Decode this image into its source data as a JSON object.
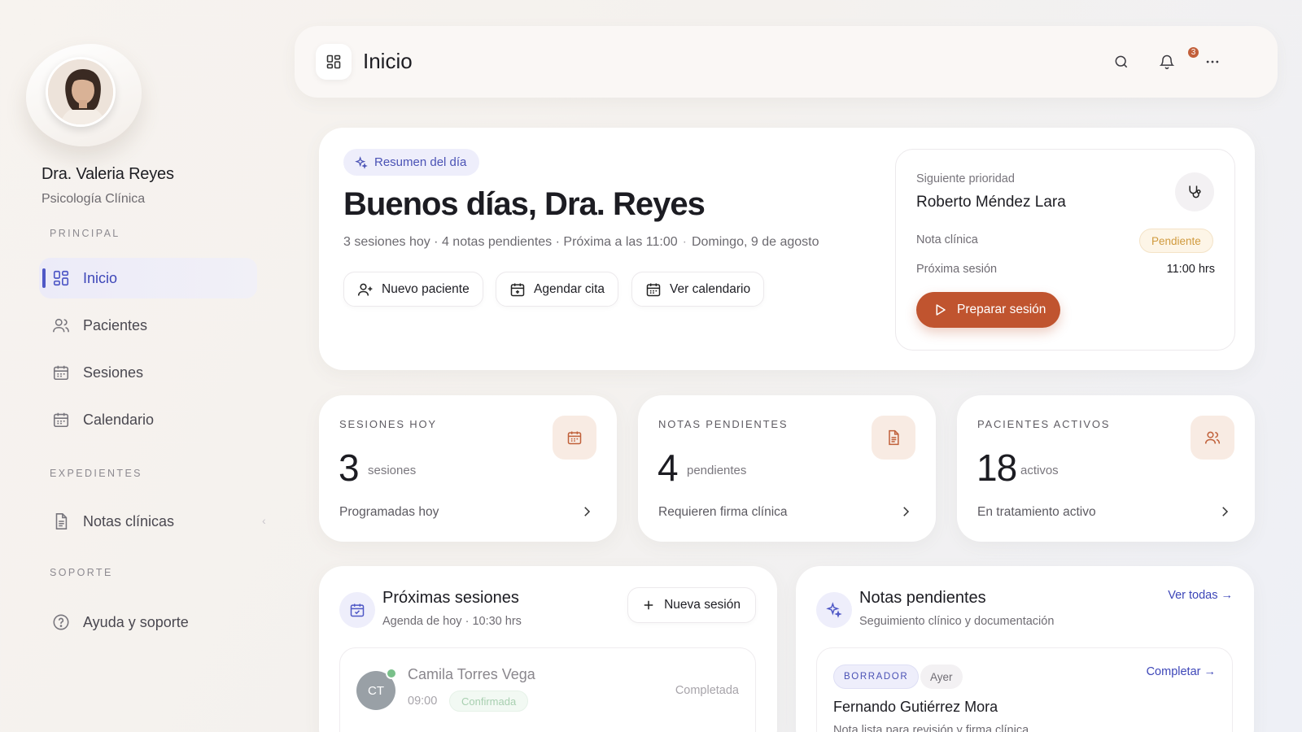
{
  "sidebar": {
    "doctor_name": "Dra. Valeria Reyes",
    "specialty": "Psicología Clínica",
    "sections": {
      "principal": "PRINCIPAL",
      "expedientes": "EXPEDIENTES",
      "soporte": "SOPORTE"
    },
    "items": [
      {
        "label": "Inicio",
        "icon": "dashboard-icon",
        "active": true
      },
      {
        "label": "Pacientes",
        "icon": "users-icon"
      },
      {
        "label": "Sesiones",
        "icon": "calendar-icon"
      },
      {
        "label": "Calendario",
        "icon": "calendar-icon"
      },
      {
        "label": "Notas clínicas",
        "icon": "document-icon"
      },
      {
        "label": "Ayuda y soporte",
        "icon": "help-icon"
      }
    ]
  },
  "topbar": {
    "title": "Inicio",
    "notification_count": "3"
  },
  "hero": {
    "summary_pill": "Resumen del día",
    "greeting": "Buenos días, Dra. Reyes",
    "summary": "3 sesiones hoy · 4 notas pendientes · Próxima a las 11:00",
    "date": "Domingo, 9 de agosto",
    "actions": {
      "new_patient": "Nuevo paciente",
      "schedule": "Agendar cita",
      "calendar": "Ver calendario"
    }
  },
  "priority": {
    "label": "Siguiente prioridad",
    "patient": "Roberto Méndez Lara",
    "note_label": "Nota clínica",
    "note_status": "Pendiente",
    "next_label": "Próxima sesión",
    "next_time": "11:00 hrs",
    "button": "Preparar sesión"
  },
  "stats": [
    {
      "label": "SESIONES HOY",
      "value": "3",
      "unit": "sesiones",
      "footer": "Programadas hoy",
      "icon": "calendar-icon"
    },
    {
      "label": "NOTAS PENDIENTES",
      "value": "4",
      "unit": "pendientes",
      "footer": "Requieren firma clínica",
      "icon": "document-icon"
    },
    {
      "label": "PACIENTES ACTIVOS",
      "value": "18",
      "unit": "activos",
      "footer": "En tratamiento activo",
      "icon": "users-icon"
    }
  ],
  "upcoming": {
    "title": "Próximas sesiones",
    "subtitle": "Agenda de hoy · 10:30 hrs",
    "button": "Nueva sesión",
    "sessions": [
      {
        "initials": "CT",
        "name": "Camila Torres Vega",
        "time": "09:00",
        "status": "Confirmada",
        "state": "Completada"
      }
    ]
  },
  "notes": {
    "title": "Notas pendientes",
    "subtitle": "Seguimiento clínico y documentación",
    "link": "Ver todas →",
    "items": [
      {
        "tag": "BORRADOR",
        "day": "Ayer",
        "action": "Completar →",
        "patient": "Fernando Gutiérrez Mora",
        "description": "Nota lista para revisión y firma clínica"
      }
    ]
  }
}
